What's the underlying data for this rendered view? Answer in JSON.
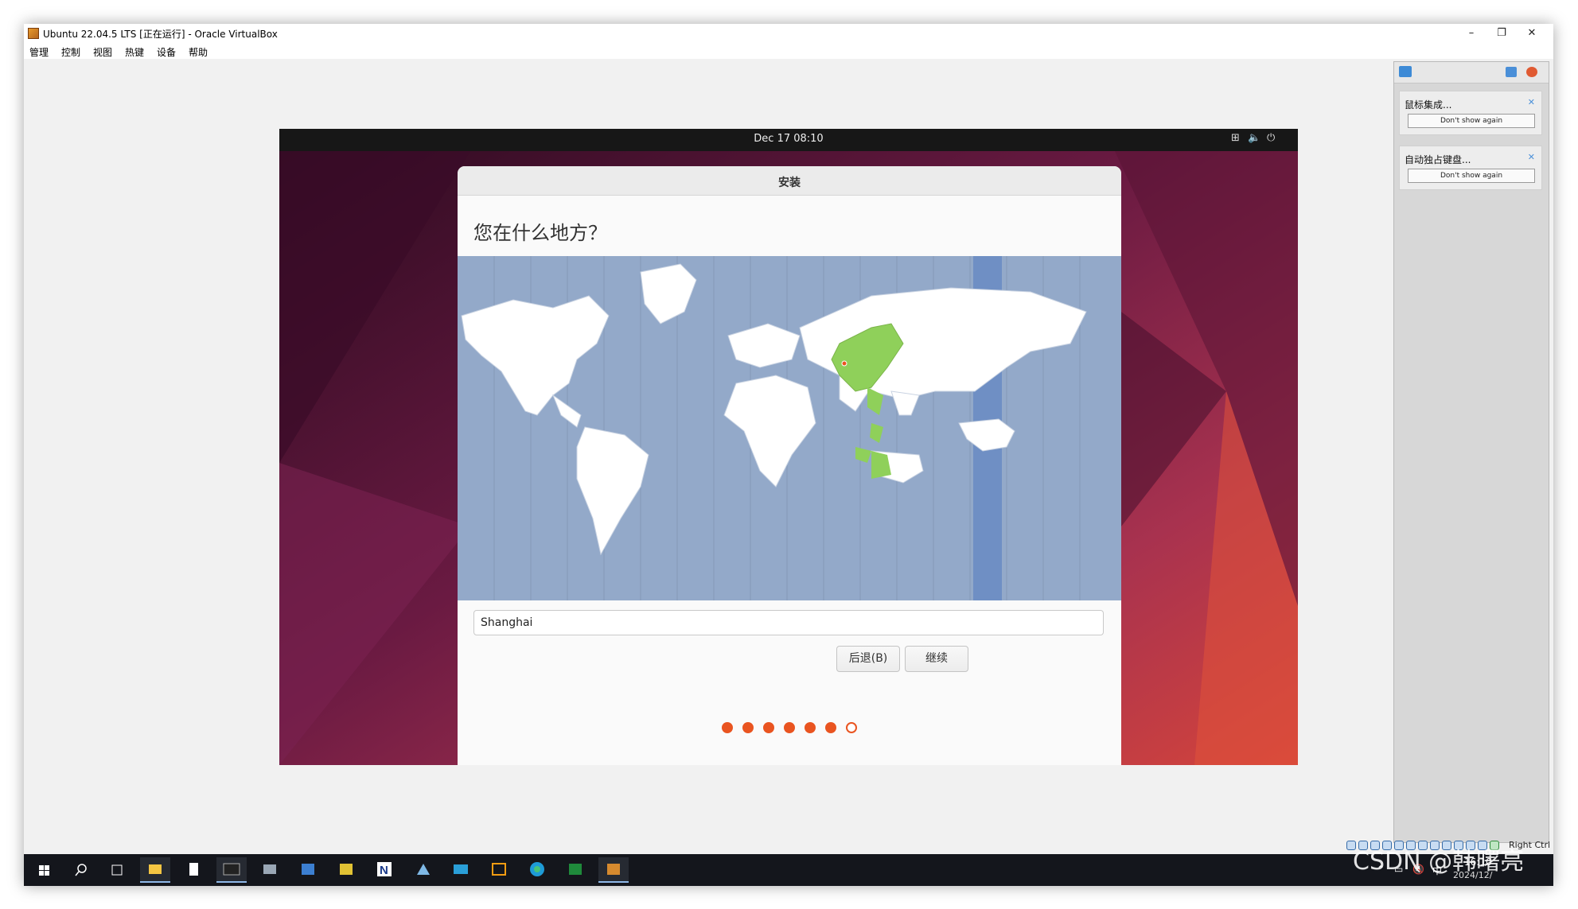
{
  "window": {
    "title": "Ubuntu 22.04.5 LTS [正在运行] - Oracle VirtualBox",
    "minimize": "–",
    "restore": "❐",
    "close": "✕"
  },
  "menu": [
    "管理",
    "控制",
    "视图",
    "热键",
    "设备",
    "帮助"
  ],
  "gnome": {
    "clock": "Dec 17  08:10",
    "tray_icons": [
      "network-icon",
      "volume-icon",
      "power-icon"
    ],
    "network_glyph": "⊞",
    "volume_glyph": "🔈",
    "power_glyph": "⏻"
  },
  "installer": {
    "title": "安装",
    "question": "您在什么地方？",
    "timezone_value": "Shanghai",
    "back_label": "后退(B)",
    "continue_label": "继续",
    "progress": {
      "completed_steps": 6,
      "total_steps": 7
    },
    "highlight_color": "#8fd05a",
    "accent_color": "#e95420"
  },
  "notifications": [
    {
      "title": "鼠标集成...",
      "button": "Don't show again",
      "close": "✕"
    },
    {
      "title": "自动独占键盘...",
      "button": "Don't show again",
      "close": "✕"
    }
  ],
  "statusbar": {
    "host_key": "Right Ctrl"
  },
  "taskbar": {
    "time": "16:10",
    "date": "2024/12/",
    "lang": "中",
    "apps": [
      "windows-start-icon",
      "search-icon",
      "task-view-icon",
      "file-explorer-icon",
      "notepad-icon",
      "terminal-icon",
      "app-icon",
      "app-icon",
      "app-icon",
      "onenote-icon",
      "app-icon",
      "app-icon",
      "app-icon",
      "edge-icon",
      "app-icon",
      "virtualbox-icon"
    ]
  },
  "watermark": "CSDN @韩曙亮"
}
